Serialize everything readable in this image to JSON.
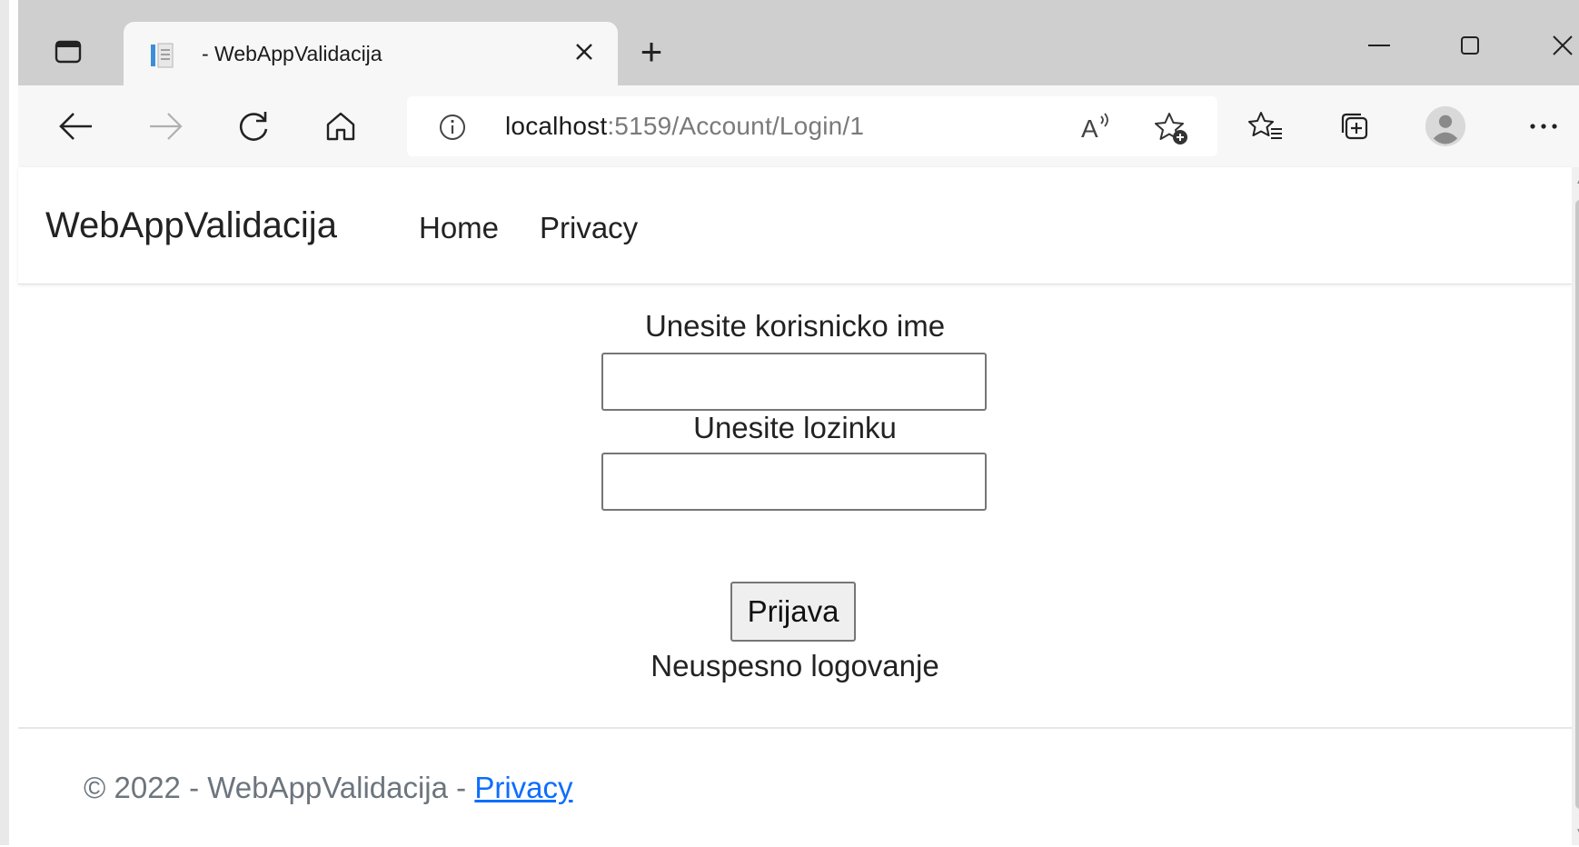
{
  "browser": {
    "tab": {
      "title": "- WebAppValidacija",
      "close_icon": "close-icon",
      "favicon": "page-favicon-icon"
    },
    "new_tab_label": "+",
    "address": {
      "host": "localhost",
      "rest": ":5159/Account/Login/1"
    },
    "icons": [
      "tab-actions-icon",
      "back-icon",
      "forward-icon",
      "refresh-icon",
      "home-icon",
      "site-info-icon",
      "read-aloud-icon",
      "add-favorite-icon",
      "favorites-icon",
      "collections-icon",
      "profile-icon",
      "more-icon",
      "minimize-icon",
      "maximize-icon",
      "close-window-icon"
    ]
  },
  "navbar": {
    "brand": "WebAppValidacija",
    "links": [
      {
        "label": "Home"
      },
      {
        "label": "Privacy"
      }
    ]
  },
  "form": {
    "username_label": "Unesite korisnicko ime",
    "username_value": "",
    "password_label": "Unesite lozinku",
    "password_value": "",
    "submit_label": "Prijava",
    "message": "Neuspesno logovanje"
  },
  "footer": {
    "text": "© 2022 - WebAppValidacija - ",
    "link": "Privacy"
  },
  "colors": {
    "link": "#0d6efd",
    "footer_text": "#6c757d",
    "titlebar": "#cfcfcf",
    "toolbar": "#f7f7f7"
  }
}
